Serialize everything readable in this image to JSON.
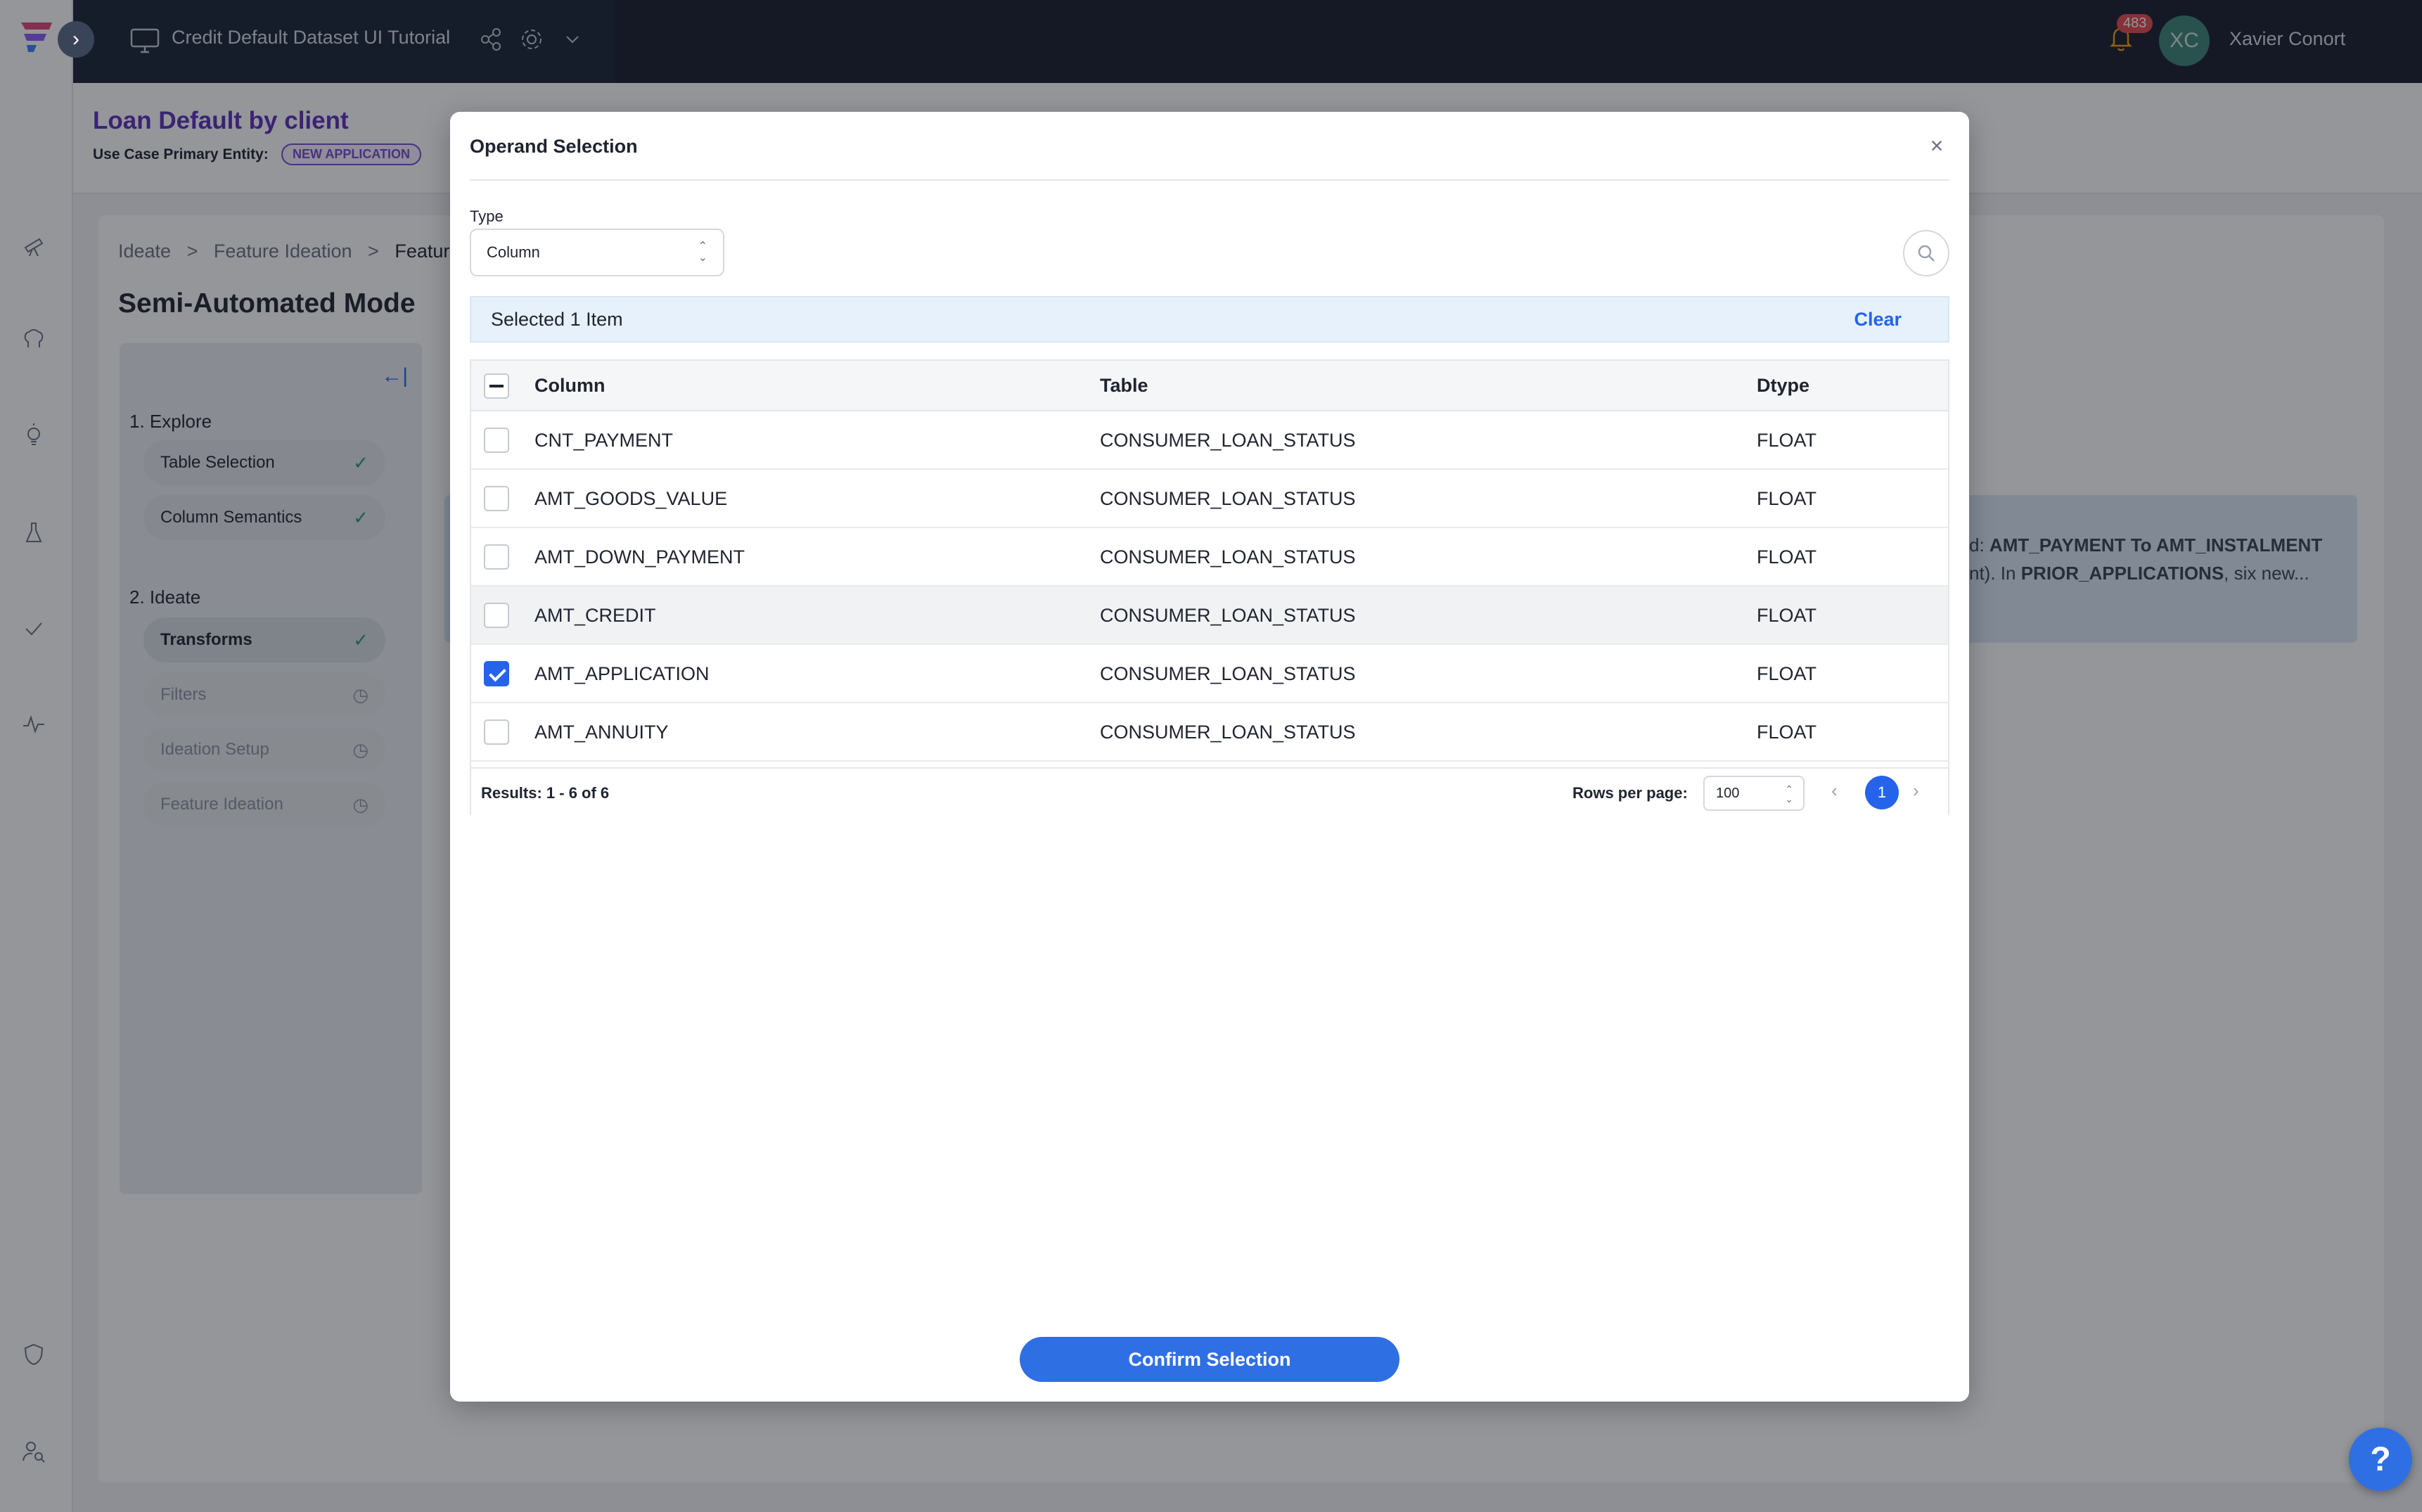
{
  "topbar": {
    "project_title": "Credit Default Dataset UI Tutorial",
    "notification_count": "483",
    "user_initials": "XC",
    "user_name": "Xavier Conort"
  },
  "page": {
    "title": "Loan Default by client",
    "entity_label": "Use Case Primary Entity:",
    "entity_value": "NEW APPLICATION",
    "breadcrumb": [
      "Ideate",
      ">",
      "Feature Ideation",
      ">",
      "Feature"
    ],
    "mode_title": "Semi-Automated Mode"
  },
  "sidebar": {
    "collapse_label": "←|",
    "sections": [
      {
        "label": "1. Explore"
      },
      {
        "label": "2. Ideate"
      }
    ],
    "steps": [
      {
        "label": "Table Selection",
        "status": "✓"
      },
      {
        "label": "Column Semantics",
        "status": "✓"
      },
      {
        "label": "Transforms",
        "status": "✓"
      },
      {
        "label": "Filters",
        "status": "◷"
      },
      {
        "label": "Ideation Setup",
        "status": "◷"
      },
      {
        "label": "Feature Ideation",
        "status": "◷"
      }
    ]
  },
  "background_text": {
    "banner_line1_prefix": "d:",
    "banner_line1_bold": "AMT_PAYMENT To AMT_INSTALMENT",
    "banner_line2_prefix": "nt). In",
    "banner_line2_bold": "PRIOR_APPLICATIONS",
    "banner_line2_suffix": ", six new..."
  },
  "modal": {
    "title": "Operand Selection",
    "close_label": "×",
    "type_label": "Type",
    "type_value": "Column",
    "selected_text": "Selected 1 Item",
    "clear_label": "Clear",
    "columns": [
      "Column",
      "Table",
      "Dtype"
    ],
    "rows": [
      {
        "column": "CNT_PAYMENT",
        "table": "CONSUMER_LOAN_STATUS",
        "dtype": "FLOAT",
        "checked": false
      },
      {
        "column": "AMT_GOODS_VALUE",
        "table": "CONSUMER_LOAN_STATUS",
        "dtype": "FLOAT",
        "checked": false
      },
      {
        "column": "AMT_DOWN_PAYMENT",
        "table": "CONSUMER_LOAN_STATUS",
        "dtype": "FLOAT",
        "checked": false
      },
      {
        "column": "AMT_CREDIT",
        "table": "CONSUMER_LOAN_STATUS",
        "dtype": "FLOAT",
        "checked": false
      },
      {
        "column": "AMT_APPLICATION",
        "table": "CONSUMER_LOAN_STATUS",
        "dtype": "FLOAT",
        "checked": true
      },
      {
        "column": "AMT_ANNUITY",
        "table": "CONSUMER_LOAN_STATUS",
        "dtype": "FLOAT",
        "checked": false
      }
    ],
    "results_text": "Results: 1 - 6 of 6",
    "rows_per_page_label": "Rows per page:",
    "rows_per_page_value": "100",
    "current_page": "1",
    "confirm_label": "Confirm Selection"
  },
  "help_label": "?",
  "colors": {
    "accent": "#2f6fe4",
    "title_purple": "#5b2fb8",
    "topbar_bg": "#161d2b",
    "selection_bar_bg": "#e7f1fb"
  }
}
